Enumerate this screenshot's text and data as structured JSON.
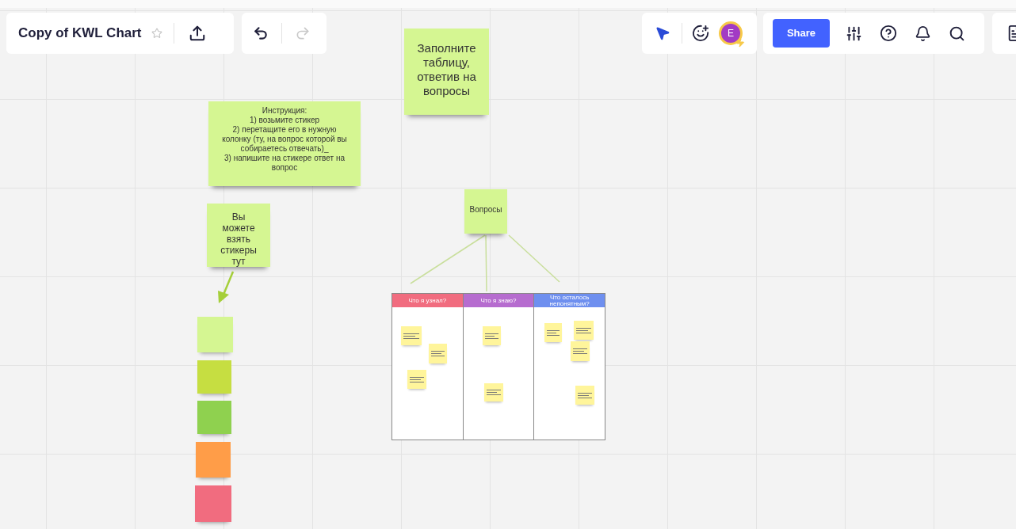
{
  "board": {
    "title": "Copy of KWL Chart",
    "starred": false
  },
  "share_button": "Share",
  "avatar": {
    "initial": "E"
  },
  "stickies": [
    {
      "kind": "title",
      "text": "Заполните таблицу, ответив на вопросы"
    },
    {
      "kind": "instruction",
      "text": "Инструкция:\n1) возьмите стикер\n2) перетащите его в нужную колонку (ту, на вопрос которой вы собираетесь отвечать)_\n3) напишите на стикере ответ на вопрос"
    },
    {
      "kind": "hint",
      "text": "Вы можете взять стикеры тут"
    },
    {
      "kind": "hub",
      "text": "Вопросы"
    }
  ],
  "palette": [
    {
      "color": "#d5f692"
    },
    {
      "color": "#c6de41"
    },
    {
      "color": "#8fd14f"
    },
    {
      "color": "#ff9d48"
    },
    {
      "color": "#f16c7f"
    }
  ],
  "table": {
    "columns": [
      {
        "header": "Что я узнал?",
        "color": "#f16c7f",
        "notes": [
          {
            "kind": "sticky"
          },
          {
            "kind": "sticky"
          },
          {
            "kind": "sticky"
          }
        ]
      },
      {
        "header": "Что я знаю?",
        "color": "#b66ccf",
        "notes": [
          {
            "kind": "sticky"
          },
          {
            "kind": "sticky"
          }
        ]
      },
      {
        "header": "Что осталось непонятным?",
        "color": "#6e8fef",
        "notes": [
          {
            "kind": "sticky"
          },
          {
            "kind": "sticky"
          },
          {
            "kind": "sticky"
          },
          {
            "kind": "sticky"
          }
        ]
      }
    ]
  }
}
